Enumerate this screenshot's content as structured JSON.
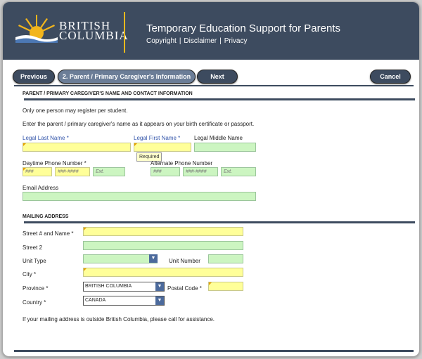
{
  "header": {
    "brand_line1": "BRITISH",
    "brand_line2": "COLUMBIA",
    "title": "Temporary Education Support for Parents",
    "links": [
      "Copyright",
      "Disclaimer",
      "Privacy"
    ],
    "colors": {
      "banner": "#3d4b5f",
      "accent": "#e8b81d"
    }
  },
  "nav": {
    "previous": "Previous",
    "step": "2. Parent / Primary Caregiver's Information",
    "next": "Next",
    "cancel": "Cancel"
  },
  "parent_section": {
    "heading": "PARENT / PRIMARY CAREGIVER'S NAME AND CONTACT INFORMATION",
    "note1": "Only one person may register per student.",
    "note2": "Enter the parent / primary caregiver's name as it appears on your birth certificate or passport.",
    "legal_last_name": "Legal Last Name *",
    "legal_first_name": "Legal First Name *",
    "legal_middle_name": "Legal Middle Name",
    "tooltip": "Required",
    "daytime_phone": "Daytime Phone Number *",
    "alternate_phone": "Alternate Phone Number",
    "phone_placeholders": {
      "area": "###",
      "number": "###-####",
      "ext": "Ext."
    },
    "email": "Email Address"
  },
  "mailing_section": {
    "heading": "MAILING ADDRESS",
    "street": "Street # and Name *",
    "street2": "Street 2",
    "unit_type": "Unit Type",
    "unit_number": "Unit Number",
    "city": "City *",
    "province": "Province *",
    "province_value": "BRITISH COLUMBIA",
    "postal_code": "Postal Code *",
    "country": "Country *",
    "country_value": "CANADA",
    "footer_note": "If your mailing address is outside British Columbia, please call for assistance."
  },
  "field_colors": {
    "required": "#ffff99",
    "optional": "#ccf5c1"
  }
}
